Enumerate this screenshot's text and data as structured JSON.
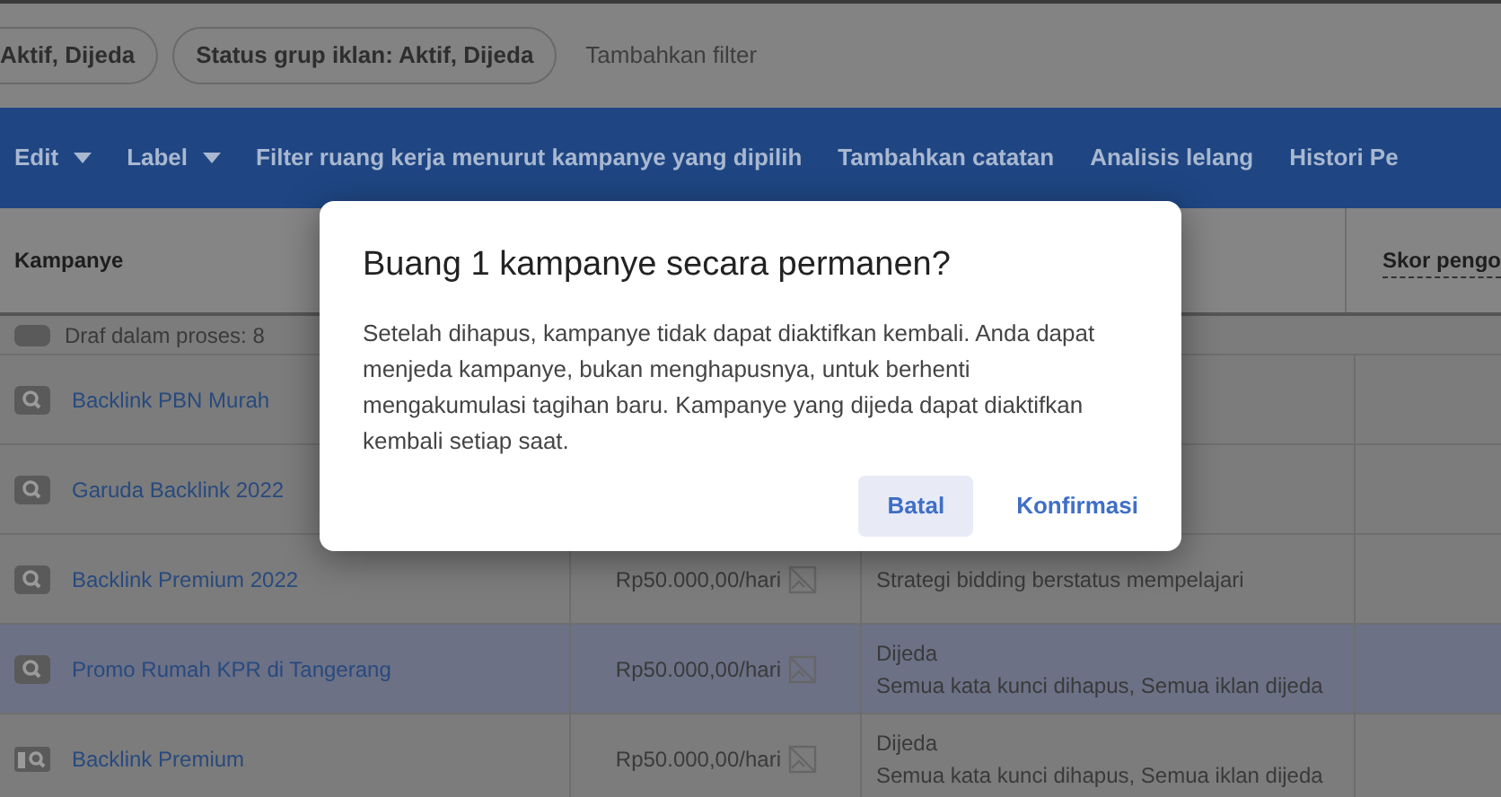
{
  "filters": {
    "chips": [
      {
        "label": "Aktif, Dijeda"
      },
      {
        "label": "Status grup iklan: Aktif, Dijeda"
      }
    ],
    "add_filter": "Tambahkan filter"
  },
  "toolbar": {
    "items": [
      {
        "label": "Edit",
        "dropdown": true
      },
      {
        "label": "Label",
        "dropdown": true
      },
      {
        "label": "Filter ruang kerja menurut kampanye yang dipilih",
        "dropdown": false
      },
      {
        "label": "Tambahkan catatan",
        "dropdown": false
      },
      {
        "label": "Analisis lelang",
        "dropdown": false
      },
      {
        "label": "Histori Pe",
        "dropdown": false
      }
    ]
  },
  "table": {
    "columns": [
      {
        "label": "Kampanye"
      },
      {
        "label": "Skor pengo"
      }
    ],
    "draft_note": "Draf dalam proses: 8",
    "rows": [
      {
        "name": "Backlink PBN Murah",
        "kind": "search",
        "selected": false
      },
      {
        "name": "Garuda Backlink 2022",
        "kind": "search",
        "selected": false
      },
      {
        "name": "Backlink Premium 2022",
        "kind": "search",
        "selected": false,
        "budget": "Rp50.000,00/hari",
        "status": [
          "Strategi bidding berstatus mempelajari"
        ]
      },
      {
        "name": "Promo Rumah KPR di Tangerang",
        "kind": "search",
        "selected": true,
        "budget": "Rp50.000,00/hari",
        "status": [
          "Dijeda",
          "Semua kata kunci dihapus, Semua iklan dijeda"
        ]
      },
      {
        "name": "Backlink Premium",
        "kind": "display",
        "selected": false,
        "budget": "Rp50.000,00/hari",
        "status": [
          "Dijeda",
          "Semua kata kunci dihapus, Semua iklan dijeda"
        ]
      }
    ]
  },
  "dialog": {
    "title": "Buang 1 kampanye secara permanen?",
    "body": "Setelah dihapus, kampanye tidak dapat diaktifkan kembali. Anda dapat menjeda kampanye, bukan menghapusnya, untuk berhenti mengakumulasi tagihan baru. Kampanye yang dijeda dapat diaktifkan kembali setiap saat.",
    "buttons": [
      {
        "label": "Batal",
        "kind": "tonal"
      },
      {
        "label": "Konfirmasi",
        "kind": "text"
      }
    ]
  }
}
